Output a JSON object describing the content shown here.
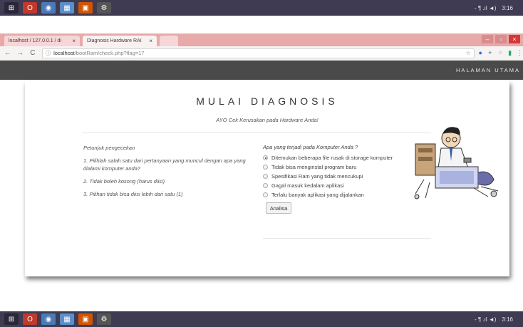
{
  "taskbar": {
    "time": "3:16",
    "network": "-  ¶  .ıl  ◄)"
  },
  "browser": {
    "tabs": [
      {
        "label": "localhost / 127.0.0.1 / di"
      },
      {
        "label": "Diagnosis Hardware RAI"
      }
    ],
    "url_host": "localhost",
    "url_path": "/bootRam/check.php?flag=17"
  },
  "site": {
    "nav_link": "HALAMAN UTAMA"
  },
  "page": {
    "title": "MULAI DIAGNOSIS",
    "subtitle": "AYO Cek Kerusakan pada Hardware Anda!",
    "instructions_heading": "Petunjuk pengecekan",
    "instructions": [
      "1. Pilihlah salah satu dari pertanyaan yang muncul dengan apa yang dialami komputer anda?",
      "2. Tidak boleh kosong (harus diisi)",
      "3. Pilihan tidak bisa diisi lebih dari satu (1)"
    ],
    "question": "Apa yang terjadi pada Komputer Anda ?",
    "options": [
      {
        "label": "Ditemukan beberapa file rusak di storage komputer",
        "checked": true
      },
      {
        "label": "Tidak bisa menginstal program baru",
        "checked": false
      },
      {
        "label": "Spesifikasi Ram yang tidak mencukupi",
        "checked": false
      },
      {
        "label": "Gagal masuk kedalam aplikasi",
        "checked": false
      },
      {
        "label": "Terlalu banyak aplikasi yang dijalankan",
        "checked": false
      }
    ],
    "submit_label": "Analisa"
  }
}
